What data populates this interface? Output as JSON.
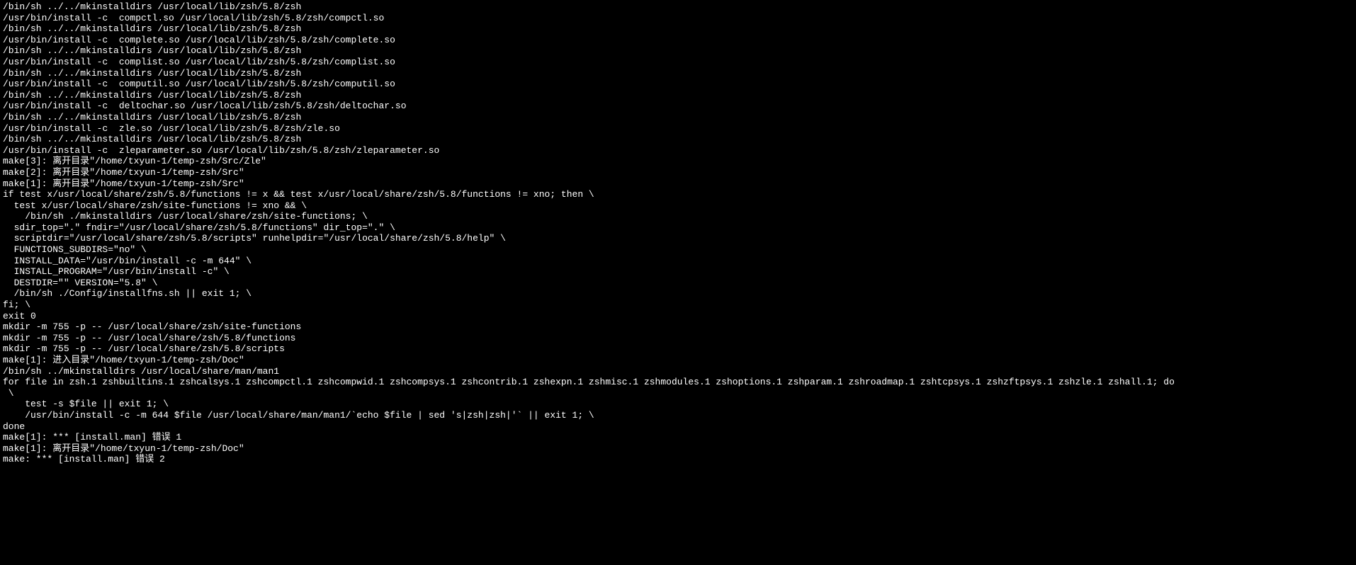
{
  "terminal": {
    "lines": [
      "/bin/sh ../../mkinstalldirs /usr/local/lib/zsh/5.8/zsh",
      "/usr/bin/install -c  compctl.so /usr/local/lib/zsh/5.8/zsh/compctl.so",
      "/bin/sh ../../mkinstalldirs /usr/local/lib/zsh/5.8/zsh",
      "/usr/bin/install -c  complete.so /usr/local/lib/zsh/5.8/zsh/complete.so",
      "/bin/sh ../../mkinstalldirs /usr/local/lib/zsh/5.8/zsh",
      "/usr/bin/install -c  complist.so /usr/local/lib/zsh/5.8/zsh/complist.so",
      "/bin/sh ../../mkinstalldirs /usr/local/lib/zsh/5.8/zsh",
      "/usr/bin/install -c  computil.so /usr/local/lib/zsh/5.8/zsh/computil.so",
      "/bin/sh ../../mkinstalldirs /usr/local/lib/zsh/5.8/zsh",
      "/usr/bin/install -c  deltochar.so /usr/local/lib/zsh/5.8/zsh/deltochar.so",
      "/bin/sh ../../mkinstalldirs /usr/local/lib/zsh/5.8/zsh",
      "/usr/bin/install -c  zle.so /usr/local/lib/zsh/5.8/zsh/zle.so",
      "/bin/sh ../../mkinstalldirs /usr/local/lib/zsh/5.8/zsh",
      "/usr/bin/install -c  zleparameter.so /usr/local/lib/zsh/5.8/zsh/zleparameter.so",
      "make[3]: 离开目录\"/home/txyun-1/temp-zsh/Src/Zle\"",
      "make[2]: 离开目录\"/home/txyun-1/temp-zsh/Src\"",
      "make[1]: 离开目录\"/home/txyun-1/temp-zsh/Src\"",
      "if test x/usr/local/share/zsh/5.8/functions != x && test x/usr/local/share/zsh/5.8/functions != xno; then \\",
      "  test x/usr/local/share/zsh/site-functions != xno && \\",
      "    /bin/sh ./mkinstalldirs /usr/local/share/zsh/site-functions; \\",
      "  sdir_top=\".\" fndir=\"/usr/local/share/zsh/5.8/functions\" dir_top=\".\" \\",
      "  scriptdir=\"/usr/local/share/zsh/5.8/scripts\" runhelpdir=\"/usr/local/share/zsh/5.8/help\" \\",
      "  FUNCTIONS_SUBDIRS=\"no\" \\",
      "  INSTALL_DATA=\"/usr/bin/install -c -m 644\" \\",
      "  INSTALL_PROGRAM=\"/usr/bin/install -c\" \\",
      "  DESTDIR=\"\" VERSION=\"5.8\" \\",
      "  /bin/sh ./Config/installfns.sh || exit 1; \\",
      "fi; \\",
      "exit 0",
      "mkdir -m 755 -p -- /usr/local/share/zsh/site-functions",
      "mkdir -m 755 -p -- /usr/local/share/zsh/5.8/functions",
      "mkdir -m 755 -p -- /usr/local/share/zsh/5.8/scripts",
      "make[1]: 进入目录\"/home/txyun-1/temp-zsh/Doc\"",
      "/bin/sh ../mkinstalldirs /usr/local/share/man/man1",
      "for file in zsh.1 zshbuiltins.1 zshcalsys.1 zshcompctl.1 zshcompwid.1 zshcompsys.1 zshcontrib.1 zshexpn.1 zshmisc.1 zshmodules.1 zshoptions.1 zshparam.1 zshroadmap.1 zshtcpsys.1 zshzftpsys.1 zshzle.1 zshall.1; do",
      " \\",
      "    test -s $file || exit 1; \\",
      "    /usr/bin/install -c -m 644 $file /usr/local/share/man/man1/`echo $file | sed 's|zsh|zsh|'` || exit 1; \\",
      "done",
      "make[1]: *** [install.man] 错误 1",
      "make[1]: 离开目录\"/home/txyun-1/temp-zsh/Doc\"",
      "make: *** [install.man] 错误 2"
    ]
  }
}
